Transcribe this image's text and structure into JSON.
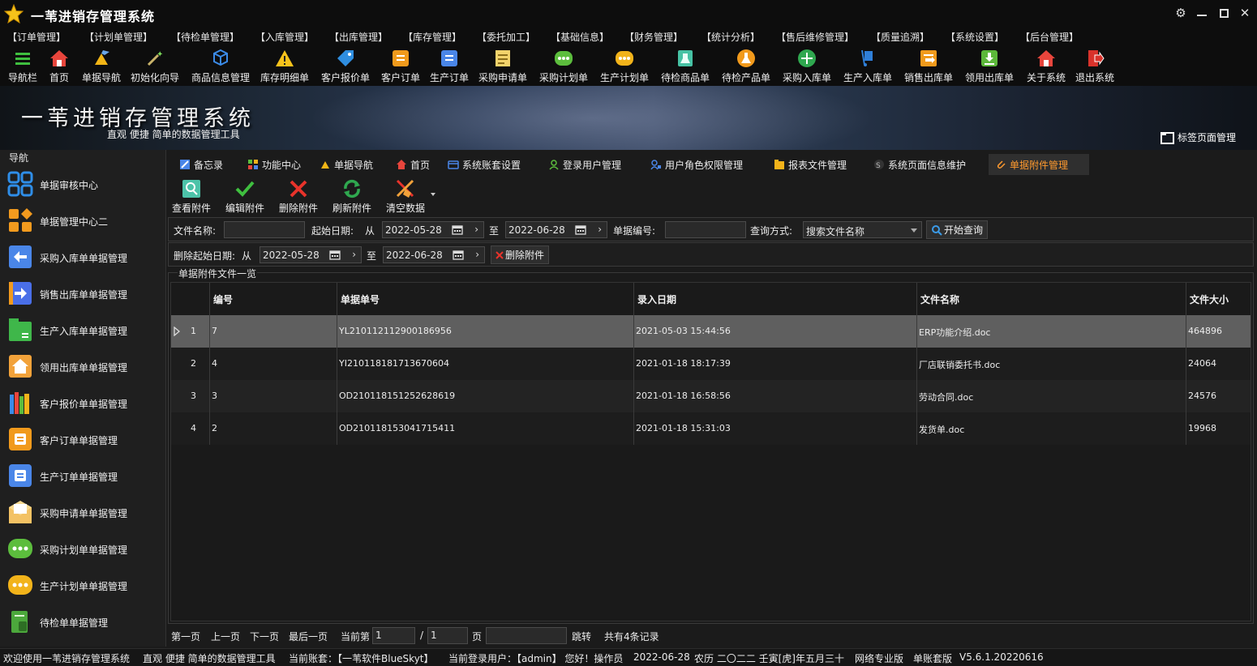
{
  "window": {
    "title": "一苇进销存管理系统"
  },
  "menu": [
    "【订单管理】",
    "【计划单管理】",
    "【待检单管理】",
    "【入库管理】",
    "【出库管理】",
    "【库存管理】",
    "【委托加工】",
    "【基础信息】",
    "【财务管理】",
    "【统计分析】",
    "【售后维修管理】",
    "【质量追溯】",
    "【系统设置】",
    "【后台管理】"
  ],
  "toolbar": [
    "导航栏",
    "首页",
    "单据导航",
    "初始化向导",
    "商品信息管理",
    "库存明细单",
    "客户报价单",
    "客户订单",
    "生产订单",
    "采购申请单",
    "采购计划单",
    "生产计划单",
    "待检商品单",
    "待检产品单",
    "采购入库单",
    "生产入库单",
    "销售出库单",
    "领用出库单",
    "关于系统",
    "退出系统"
  ],
  "banner": {
    "title": "一苇进销存管理系统",
    "subtitle": "直观 便捷 简单的数据管理工具",
    "tag_manager": "标签页面管理"
  },
  "sidebar": {
    "title": "导航",
    "items": [
      "单据审核中心",
      "单据管理中心二",
      "采购入库单单据管理",
      "销售出库单单据管理",
      "生产入库单单据管理",
      "领用出库单单据管理",
      "客户报价单单据管理",
      "客户订单单据管理",
      "生产订单单据管理",
      "采购申请单单据管理",
      "采购计划单单据管理",
      "生产计划单单据管理",
      "待检单单据管理"
    ]
  },
  "tabs": [
    "备忘录",
    "功能中心",
    "单据导航",
    "首页",
    "系统账套设置",
    "登录用户管理",
    "用户角色权限管理",
    "报表文件管理",
    "系统页面信息维护",
    "单据附件管理"
  ],
  "subtoolbar": [
    "查看附件",
    "编辑附件",
    "删除附件",
    "刷新附件",
    "清空数据"
  ],
  "query": {
    "file_name_label": "文件名称:",
    "file_name_value": "",
    "start_date_label": "起始日期:",
    "from": "从",
    "to": "至",
    "date_from": "2022-05-28",
    "date_to": "2022-06-28",
    "doc_no_label": "单据编号:",
    "doc_no_value": "",
    "query_mode_label": "查询方式:",
    "query_mode_value": "搜索文件名称",
    "search_button": "开始查询",
    "delete_start_label": "删除起始日期:",
    "delete_from": "从",
    "delete_date_from": "2022-05-28",
    "delete_to": "至",
    "delete_date_to": "2022-06-28",
    "delete_button": "删除附件"
  },
  "grid": {
    "title": "单据附件文件一览",
    "columns": [
      "编号",
      "单据单号",
      "录入日期",
      "文件名称",
      "文件大小"
    ],
    "rows": [
      {
        "n": "1",
        "id": "7",
        "doc": "YL210112112900186956",
        "date": "2021-05-03 15:44:56",
        "file": "ERP功能介绍.doc",
        "size": "464896"
      },
      {
        "n": "2",
        "id": "4",
        "doc": "YI210118181713670604",
        "date": "2021-01-18 18:17:39",
        "file": "厂店联销委托书.doc",
        "size": "24064"
      },
      {
        "n": "3",
        "id": "3",
        "doc": "OD210118151252628619",
        "date": "2021-01-18 16:58:56",
        "file": "劳动合同.doc",
        "size": "24576"
      },
      {
        "n": "4",
        "id": "2",
        "doc": "OD210118153041715411",
        "date": "2021-01-18 15:31:03",
        "file": "发货单.doc",
        "size": "19968"
      }
    ]
  },
  "pager": {
    "first": "第一页",
    "prev": "上一页",
    "next": "下一页",
    "last": "最后一页",
    "current_label": "当前第",
    "current": "1",
    "sep": "/",
    "total": "1",
    "page_unit": "页",
    "jump_value": "",
    "jump": "跳转",
    "count": "共有4条记录"
  },
  "status": {
    "welcome": "欢迎使用一苇进销存管理系统",
    "tagline": "直观 便捷 简单的数据管理工具",
    "account": "当前账套：【一苇软件BlueSkyt】",
    "user": "当前登录用户：【admin】 您好！操作员",
    "date": "2022-06-28",
    "lunar": "农历 二〇二二 壬寅[虎]年五月三十",
    "edition": "网络专业版",
    "mode": "单账套版",
    "version": "V5.6.1.20220616"
  },
  "colors": {
    "accent": "#ff9a2e",
    "bg": "#1b1b1b",
    "selected_row": "#5f5f5f"
  }
}
